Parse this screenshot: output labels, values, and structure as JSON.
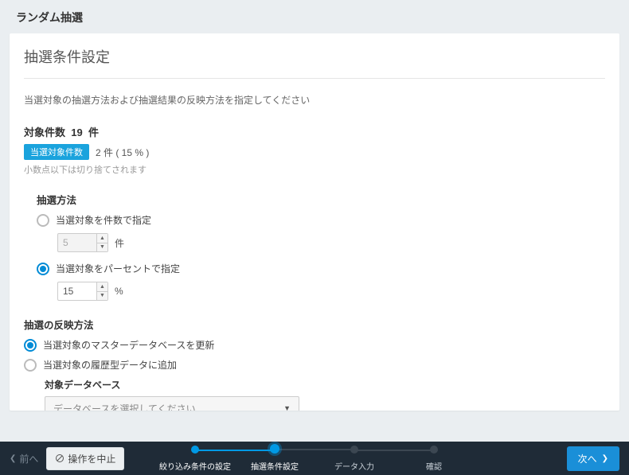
{
  "header": {
    "title": "ランダム抽選"
  },
  "card": {
    "title": "抽選条件設定",
    "instruction": "当選対象の抽選方法および抽選結果の反映方法を指定してください",
    "count_label": "対象件数",
    "count_value": "19",
    "count_unit": "件",
    "badge": "当選対象件数",
    "badge_text": "2 件 ( 15 % )",
    "note": "小数点以下は切り捨てされます"
  },
  "method": {
    "label": "抽選方法",
    "opt1": {
      "label": "当選対象を件数で指定",
      "value": "5",
      "unit": "件",
      "checked": false
    },
    "opt2": {
      "label": "当選対象をパーセントで指定",
      "value": "15",
      "unit": "%",
      "checked": true
    }
  },
  "reflect": {
    "label": "抽選の反映方法",
    "opt1": {
      "label": "当選対象のマスターデータベースを更新",
      "checked": true
    },
    "opt2": {
      "label": "当選対象の履歴型データに追加",
      "checked": false
    },
    "db_label": "対象データベース",
    "db_placeholder": "データベースを選択してください"
  },
  "footer": {
    "prev": "前へ",
    "abort": "操作を中止",
    "next": "次へ",
    "steps": [
      {
        "label": "絞り込み条件の設定",
        "state": "done"
      },
      {
        "label": "抽選条件設定",
        "state": "active"
      },
      {
        "label": "データ入力",
        "state": ""
      },
      {
        "label": "確認",
        "state": ""
      }
    ]
  }
}
